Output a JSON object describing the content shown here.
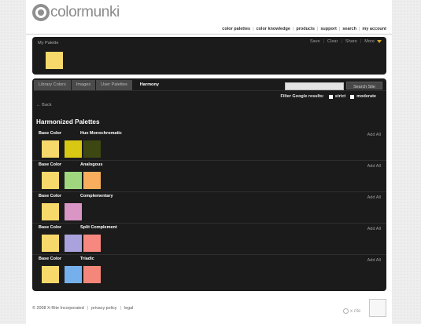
{
  "header": {
    "brand": "colormunki",
    "nav": [
      "color palettes",
      "color knowledge",
      "products",
      "support",
      "search",
      "my account"
    ]
  },
  "my_palette": {
    "title": "My Palette",
    "swatch_color": "#f7d86a",
    "actions": [
      "Save",
      "Clear",
      "Share",
      "More"
    ]
  },
  "tabs": [
    {
      "label": "Library Colors",
      "active": false
    },
    {
      "label": "Images",
      "active": false
    },
    {
      "label": "User Palettes",
      "active": false
    },
    {
      "label": "Harmony",
      "active": true
    }
  ],
  "search": {
    "placeholder": "",
    "button_label": "Search Site"
  },
  "filter": {
    "label": "Filter Google results:",
    "option_strict": "strict",
    "option_moderate": "moderate"
  },
  "back_label": "← Back",
  "heading": "Harmonized Palettes",
  "base_color_label": "Base Color",
  "add_all_label": "Add All",
  "base_color": "#f7d86a",
  "harmonies": [
    {
      "name": "Hue Monochromatic",
      "colors": [
        "#d8c814",
        "#3d4712"
      ]
    },
    {
      "name": "Analogous",
      "colors": [
        "#9fd67e",
        "#f8ae5c"
      ]
    },
    {
      "name": "Complementary",
      "colors": [
        "#d995c4"
      ]
    },
    {
      "name": "Split Complement",
      "colors": [
        "#aaa2dc",
        "#f78880"
      ]
    },
    {
      "name": "Triadic",
      "colors": [
        "#76b0ec",
        "#f5877a"
      ]
    }
  ],
  "footer": {
    "copyright": "© 2008 X-Rite Incorporated",
    "privacy": "privacy policy",
    "legal": "legal",
    "brand": "x·rite"
  },
  "colors": {
    "panel_bg": "#1b1b1b",
    "tab_bg": "#4a4a4a",
    "accent_caret": "#d9a51e"
  }
}
